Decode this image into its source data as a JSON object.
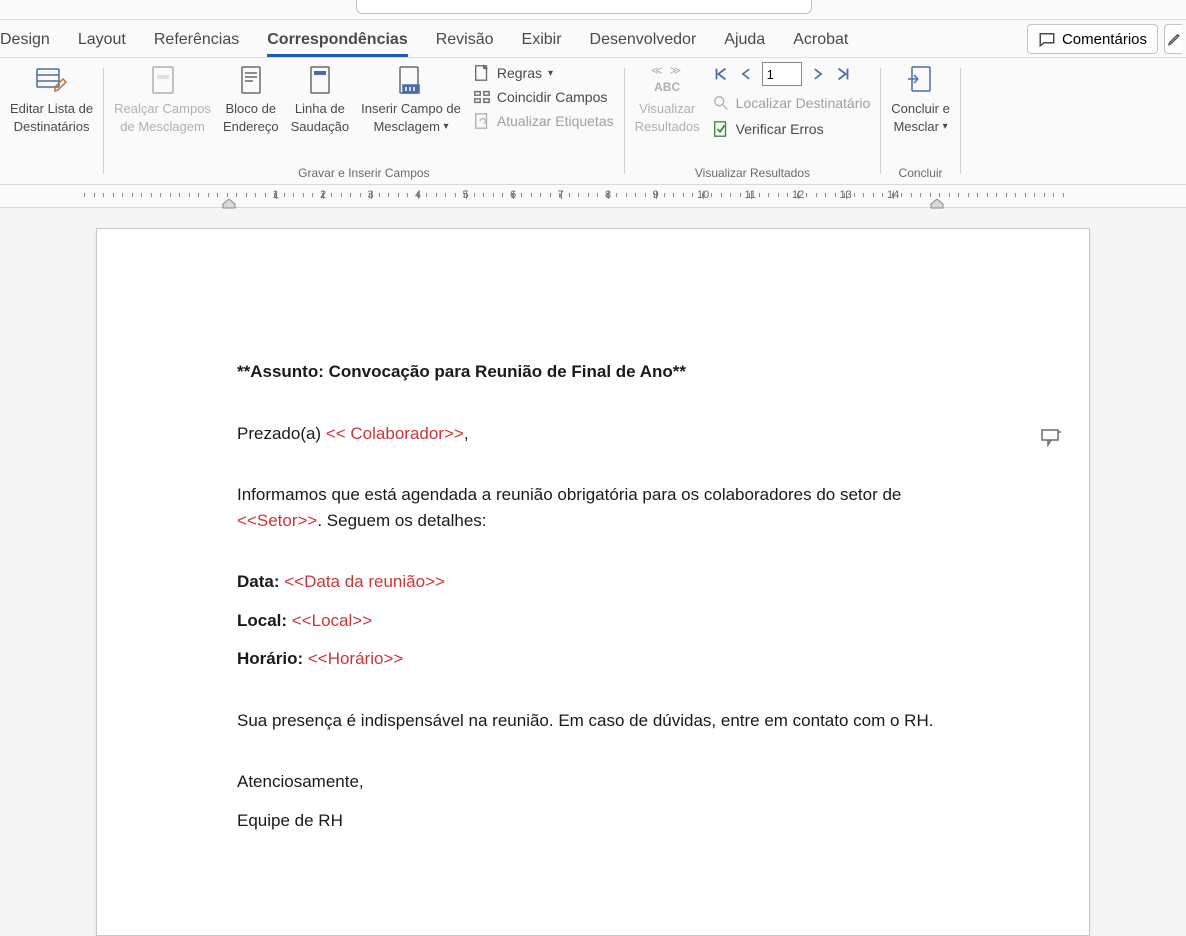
{
  "tabs": {
    "design": "Design",
    "layout": "Layout",
    "references": "Referências",
    "mailings": "Correspondências",
    "review": "Revisão",
    "view": "Exibir",
    "developer": "Desenvolvedor",
    "help": "Ajuda",
    "acrobat": "Acrobat"
  },
  "top_right": {
    "comments_label": "Comentários"
  },
  "ribbon": {
    "group1": {
      "edit_recipients": "Editar Lista de\nDestinatários"
    },
    "group2": {
      "label": "Gravar e Inserir Campos",
      "highlight": "Realçar Campos\nde Mesclagem",
      "address_block": "Bloco de\nEndereço",
      "greeting_line": "Linha de\nSaudação",
      "insert_merge_field": "Inserir Campo de\nMesclagem",
      "rules": "Regras",
      "match_fields": "Coincidir Campos",
      "update_labels": "Atualizar Etiquetas"
    },
    "group3": {
      "label": "Visualizar Resultados",
      "preview": "Visualizar\nResultados",
      "record_number": "1",
      "find_recipient": "Localizar Destinatário",
      "check_errors": "Verificar Erros"
    },
    "group4": {
      "label": "Concluir",
      "finish_merge": "Concluir e\nMesclar"
    }
  },
  "ruler_numbers": [
    "1",
    "2",
    "3",
    "4",
    "5",
    "6",
    "7",
    "8",
    "9",
    "10",
    "11",
    "12",
    "13",
    "14"
  ],
  "document": {
    "subject_line": "**Assunto: Convocação para Reunião de Final de Ano**",
    "salutation_prefix": "Prezado(a) ",
    "salutation_field": "<< Colaborador>>",
    "salutation_suffix": ",",
    "body1_prefix": "Informamos que está agendada a reunião obrigatória para os colaboradores do setor de ",
    "body1_field": "<<Setor>>",
    "body1_suffix": ". Seguem os detalhes:",
    "data_label": "Data: ",
    "data_field": "<<Data da reunião>>",
    "local_label": "Local: ",
    "local_field": "<<Local>>",
    "horario_label": "Horário: ",
    "horario_field": "<<Horário>>",
    "body2": "Sua presença é indispensável na reunião. Em caso de dúvidas, entre em contato com o RH.",
    "closing": "Atenciosamente,",
    "signature": "Equipe de RH"
  }
}
